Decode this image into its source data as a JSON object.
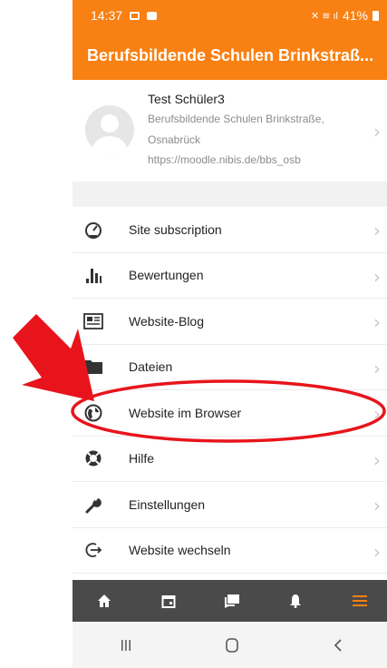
{
  "status": {
    "time": "14:37",
    "battery": "41%"
  },
  "app_title": "Berufsbildende Schulen Brinkstraß...",
  "profile": {
    "name": "Test Schüler3",
    "school": "Berufsbildende Schulen Brinkstraße,",
    "city": "Osnabrück",
    "url": "https://moodle.nibis.de/bbs_osb"
  },
  "menu": [
    {
      "label": "Site subscription",
      "icon": "gauge-icon"
    },
    {
      "label": "Bewertungen",
      "icon": "bar-chart-icon"
    },
    {
      "label": "Website-Blog",
      "icon": "newspaper-icon"
    },
    {
      "label": "Dateien",
      "icon": "folder-icon"
    },
    {
      "label": "Website im Browser",
      "icon": "globe-icon"
    },
    {
      "label": "Hilfe",
      "icon": "lifebuoy-icon"
    },
    {
      "label": "Einstellungen",
      "icon": "wrench-icon"
    },
    {
      "label": "Website wechseln",
      "icon": "sign-out-icon"
    }
  ],
  "tabs": [
    "home-icon",
    "calendar-icon",
    "messages-icon",
    "bell-icon",
    "menu-icon"
  ],
  "colors": {
    "brand": "#f98012",
    "tabbar": "#4a4a4a",
    "annotation": "#e8141c"
  }
}
